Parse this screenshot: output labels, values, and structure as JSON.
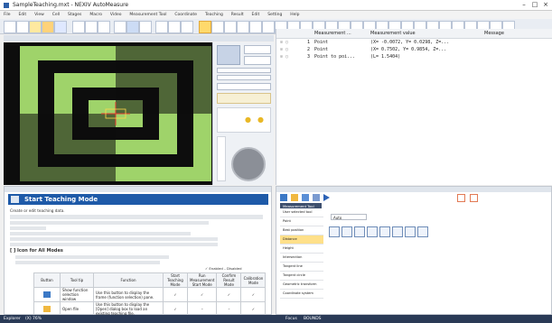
{
  "window": {
    "title": "SampleTeaching.mxt - NEXIV AutoMeasure"
  },
  "menu": [
    "File",
    "Edit",
    "View",
    "Cell",
    "Stages",
    "Macro",
    "Video",
    "Measurement Tool",
    "Coordinate",
    "Teaching",
    "Result",
    "Edit",
    "Setting",
    "Help"
  ],
  "measurement_panel": {
    "columns": [
      "Measurement ...",
      "Measurement value",
      "Message"
    ],
    "rows": [
      {
        "index": "1",
        "name": "Point",
        "value": "(X= -0.0072, Y= 0.0298, Z=..."
      },
      {
        "index": "2",
        "name": "Point",
        "value": "(X= 0.7502, Y= 0.9854, Z=..."
      },
      {
        "index": "3",
        "name": "Point to poi...",
        "value": "(L= 1.5404)"
      }
    ]
  },
  "help": {
    "banner_title": "Start Teaching Mode",
    "intro": "Create or edit teaching data.",
    "list_heading": "[ ] Icon for All Modes",
    "legend_enabled": "Enabled",
    "legend_disabled": "Disabled",
    "table_headers": [
      "Button",
      "Tool tip",
      "Function",
      "Start Teaching Mode",
      "Run Measurement Start Mode",
      "Confirm Result Mode",
      "Calibration Mode"
    ],
    "table_rows": [
      {
        "tooltip": "Show function selection window",
        "function": "Use this button to display the frame (function selection) pane."
      },
      {
        "tooltip": "Open file",
        "function": "Use this button to display the [Open] dialog box to load an existing teaching file."
      }
    ]
  },
  "teaching": {
    "tab_label": "Measurement Tool",
    "dropdown": "Auto",
    "side_items": [
      "User selected tool",
      "Point",
      "Best position",
      "Distance",
      "Height",
      "Intersection",
      "Tangent line",
      "Tangent circle",
      "Geometric transform",
      "Coordinate system"
    ]
  },
  "status": {
    "left_label": "Explorer",
    "zoom": "(X) 76%",
    "right_label": "Focus",
    "right_value": "BOUNDS"
  },
  "colors": {
    "accent": "#1e5aa8",
    "target_green": "#9fd36a",
    "status_bar": "#2a3a56"
  }
}
